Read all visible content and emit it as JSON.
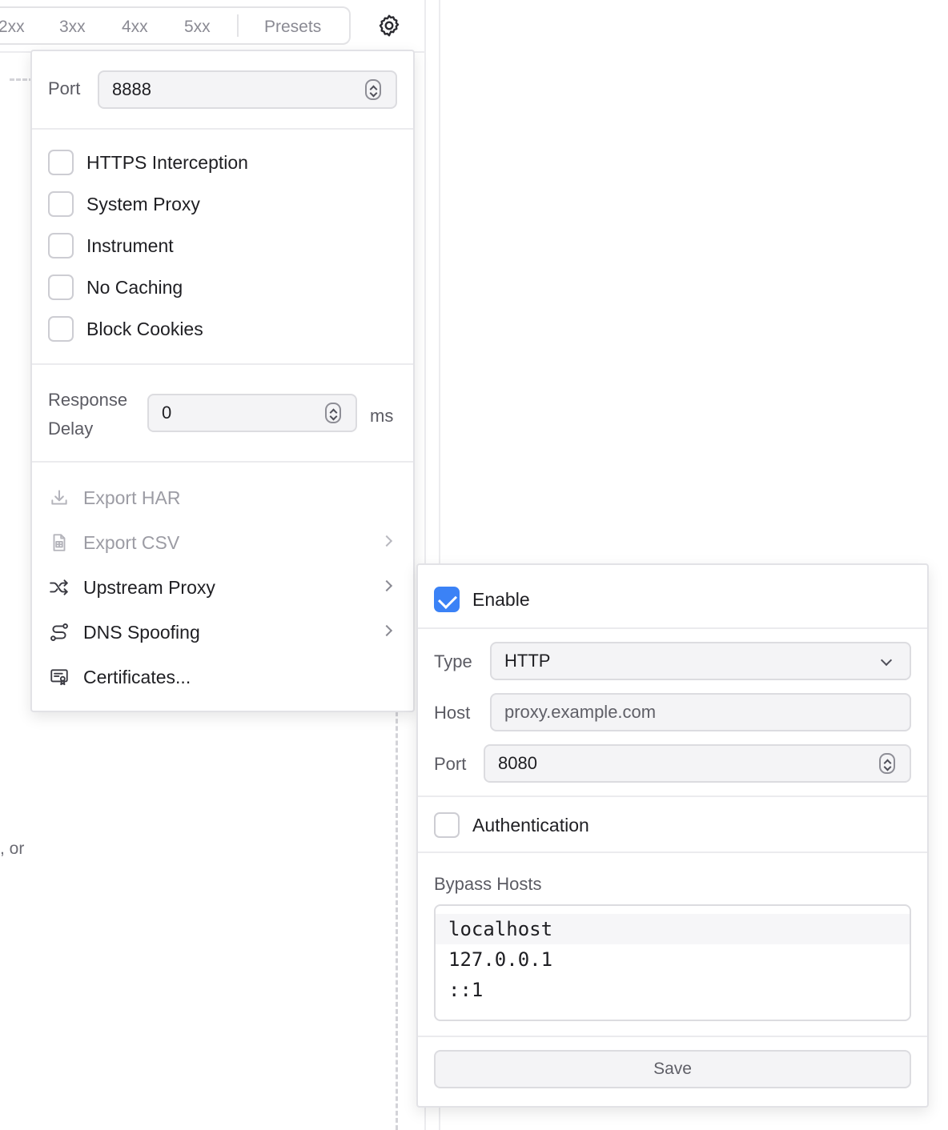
{
  "filters": {
    "items": [
      "2xx",
      "3xx",
      "4xx",
      "5xx"
    ],
    "presets": "Presets"
  },
  "background": {
    "fragment": ", or"
  },
  "settings": {
    "port_label": "Port",
    "port_value": "8888",
    "checkboxes": [
      {
        "label": "HTTPS Interception",
        "checked": false
      },
      {
        "label": "System Proxy",
        "checked": false
      },
      {
        "label": "Instrument",
        "checked": false
      },
      {
        "label": "No Caching",
        "checked": false
      },
      {
        "label": "Block Cookies",
        "checked": false
      }
    ],
    "delay_label_line1": "Response",
    "delay_label_line2": "Delay",
    "delay_value": "0",
    "delay_unit": "ms",
    "menu": [
      {
        "label": "Export HAR",
        "icon": "download-icon",
        "disabled": true,
        "submenu": false
      },
      {
        "label": "Export CSV",
        "icon": "csv-file-icon",
        "disabled": true,
        "submenu": true
      },
      {
        "label": "Upstream Proxy",
        "icon": "shuffle-icon",
        "disabled": false,
        "submenu": true
      },
      {
        "label": "DNS Spoofing",
        "icon": "route-icon",
        "disabled": false,
        "submenu": true
      },
      {
        "label": "Certificates...",
        "icon": "certificate-icon",
        "disabled": false,
        "submenu": false
      }
    ]
  },
  "upstream": {
    "enable_label": "Enable",
    "enabled": true,
    "type_label": "Type",
    "type_value": "HTTP",
    "host_label": "Host",
    "host_placeholder": "proxy.example.com",
    "port_label": "Port",
    "port_value": "8080",
    "auth_label": "Authentication",
    "auth_checked": false,
    "bypass_label": "Bypass Hosts",
    "bypass_hosts": [
      "localhost",
      "127.0.0.1",
      "::1"
    ],
    "save_label": "Save"
  },
  "colors": {
    "accent": "#3b82f6",
    "border": "#dcdce0",
    "muted_text": "#5b5b63",
    "disabled_text": "#9c9ca4"
  }
}
